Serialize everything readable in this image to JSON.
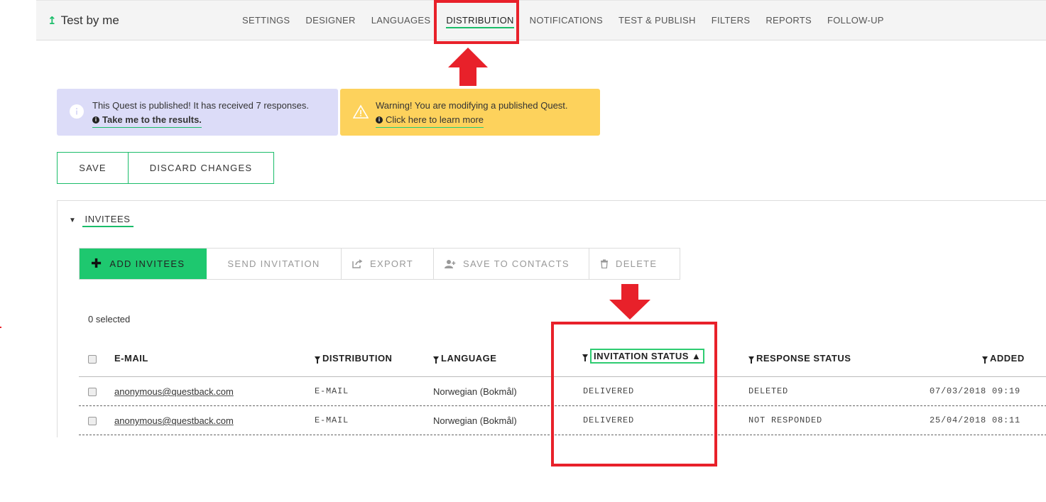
{
  "app": {
    "title": "Test by me"
  },
  "nav": {
    "tabs": [
      {
        "label": "SETTINGS"
      },
      {
        "label": "DESIGNER"
      },
      {
        "label": "LANGUAGES"
      },
      {
        "label": "DISTRIBUTION",
        "active": true
      },
      {
        "label": "NOTIFICATIONS"
      },
      {
        "label": "TEST & PUBLISH"
      },
      {
        "label": "FILTERS"
      },
      {
        "label": "REPORTS"
      },
      {
        "label": "FOLLOW-UP"
      }
    ]
  },
  "notices": {
    "info": {
      "text": "This Quest is published! It has received 7 responses.",
      "link": "Take me to the results."
    },
    "warning": {
      "text": "Warning! You are modifying a published Quest.",
      "link": "Click here to learn more"
    }
  },
  "toolbar": {
    "save_label": "SAVE",
    "discard_label": "DISCARD CHANGES"
  },
  "invitees": {
    "section_label": "INVITEES",
    "actions": {
      "add": "ADD INVITEES",
      "send": "SEND INVITATION",
      "export": "EXPORT",
      "save_contacts": "SAVE TO CONTACTS",
      "delete": "DELETE"
    },
    "selected_count": "0 selected",
    "columns": {
      "email": "E-MAIL",
      "distribution": "DISTRIBUTION",
      "language": "LANGUAGE",
      "invitation_status": "INVITATION STATUS",
      "response_status": "RESPONSE STATUS",
      "added": "ADDED"
    },
    "rows": [
      {
        "email": "anonymous@questback.com",
        "distribution": "E-MAIL",
        "language": "Norwegian (Bokmål)",
        "invitation_status": "DELIVERED",
        "response_status": "DELETED",
        "added": "07/03/2018 09:19"
      },
      {
        "email": "anonymous@questback.com",
        "distribution": "E-MAIL",
        "language": "Norwegian (Bokmål)",
        "invitation_status": "DELIVERED",
        "response_status": "NOT RESPONDED",
        "added": "25/04/2018 08:11"
      }
    ]
  },
  "colors": {
    "accent": "#1ec86f",
    "annotation": "#e8212a",
    "info_bg": "#dcdcf8",
    "warning_bg": "#fdd25c"
  }
}
